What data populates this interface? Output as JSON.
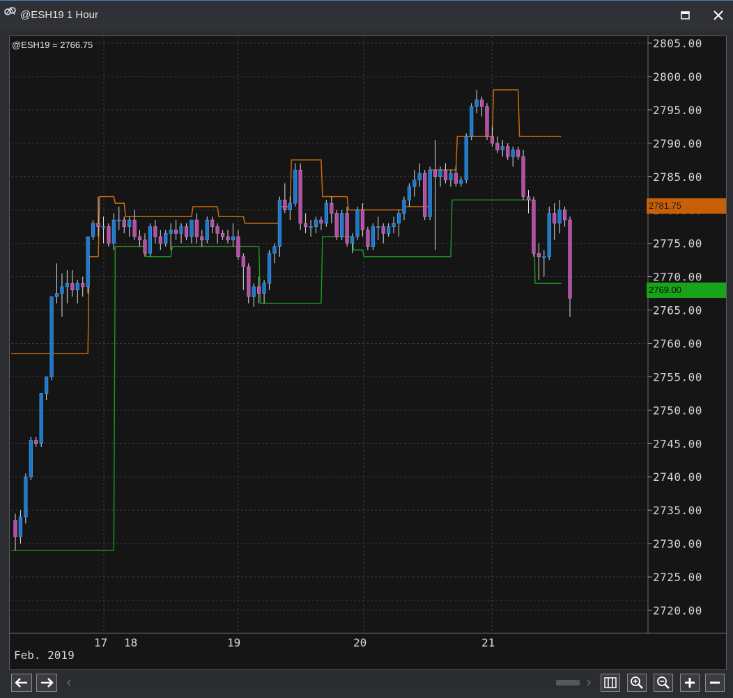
{
  "window": {
    "title": "@ESH19 1 Hour",
    "icons": {
      "app": "globe-icon",
      "maximize": "maximize-icon",
      "close": "close-icon"
    }
  },
  "chart_header": {
    "symbol_label": "@ESH19 = 2766.75"
  },
  "price_tags": {
    "upper": {
      "value": "2781.75",
      "color": "#c8600a"
    },
    "lower": {
      "value": "2769.00",
      "color": "#18a418"
    }
  },
  "x_axis": {
    "month_label": "Feb. 2019",
    "day_labels": [
      "17",
      "18",
      "19",
      "20",
      "21"
    ]
  },
  "colors": {
    "background": "#151515",
    "bull_body": "#1e77c8",
    "bear_body": "#b34fa2",
    "wick": "#e0e0e0",
    "upper_channel": "#d1700f",
    "lower_channel": "#1f9a1f",
    "grid": "#3a3a3a"
  },
  "toolbar": {
    "scroll_left": "arrow-left-icon",
    "scroll_right": "arrow-right-icon",
    "bars_icon": "bar-spacing-icon",
    "zoom_in": "zoom-in-icon",
    "zoom_out": "zoom-out-icon",
    "add": "plus-icon",
    "remove": "minus-icon"
  },
  "chart_data": {
    "type": "candlestick",
    "symbol": "@ESH19",
    "interval": "1 Hour",
    "last_price": 2766.75,
    "ylim": [
      2715,
      2806
    ],
    "y_ticks": [
      "2805.00",
      "2800.00",
      "2795.00",
      "2790.00",
      "2785.00",
      "2780.00",
      "2775.00",
      "2770.00",
      "2765.00",
      "2760.00",
      "2755.00",
      "2750.00",
      "2745.00",
      "2740.00",
      "2735.00",
      "2730.00",
      "2725.00",
      "2720.00"
    ],
    "x_day_labels": [
      "17",
      "18",
      "19",
      "20",
      "21"
    ],
    "grid": true,
    "candles": [
      [
        2733.5,
        2734.5,
        2729.0,
        2731.0
      ],
      [
        2731.0,
        2735.0,
        2730.0,
        2734.0
      ],
      [
        2734.0,
        2740.5,
        2733.0,
        2740.0
      ],
      [
        2740.0,
        2746.0,
        2739.5,
        2745.5
      ],
      [
        2745.5,
        2746.0,
        2744.5,
        2745.0
      ],
      [
        2745.0,
        2752.5,
        2744.5,
        2752.5
      ],
      [
        2752.5,
        2755.0,
        2751.5,
        2755.0
      ],
      [
        2755.0,
        2767.0,
        2754.5,
        2767.0
      ],
      [
        2767.0,
        2772.0,
        2766.0,
        2767.5
      ],
      [
        2767.5,
        2770.5,
        2764.0,
        2768.5
      ],
      [
        2768.5,
        2771.0,
        2766.0,
        2769.0
      ],
      [
        2769.0,
        2771.0,
        2767.0,
        2768.0
      ],
      [
        2768.0,
        2769.5,
        2766.0,
        2769.0
      ],
      [
        2769.0,
        2770.0,
        2767.0,
        2768.5
      ],
      [
        2768.5,
        2776.0,
        2767.5,
        2776.0
      ],
      [
        2776.0,
        2778.5,
        2775.5,
        2778.0
      ],
      [
        2778.0,
        2782.0,
        2776.0,
        2777.5
      ],
      [
        2777.5,
        2779.0,
        2775.0,
        2777.5
      ],
      [
        2777.5,
        2778.0,
        2774.5,
        2775.0
      ],
      [
        2775.0,
        2779.5,
        2774.0,
        2778.5
      ],
      [
        2778.5,
        2780.5,
        2777.0,
        2778.5
      ],
      [
        2778.5,
        2779.0,
        2776.5,
        2777.5
      ],
      [
        2777.5,
        2779.0,
        2776.0,
        2778.5
      ],
      [
        2778.5,
        2780.0,
        2775.5,
        2776.0
      ],
      [
        2776.0,
        2777.0,
        2774.5,
        2775.5
      ],
      [
        2775.5,
        2776.5,
        2773.0,
        2773.5
      ],
      [
        2773.5,
        2778.0,
        2773.0,
        2777.5
      ],
      [
        2777.5,
        2778.5,
        2775.0,
        2776.0
      ],
      [
        2776.0,
        2777.0,
        2774.0,
        2775.0
      ],
      [
        2775.0,
        2777.0,
        2774.5,
        2776.5
      ],
      [
        2776.5,
        2778.0,
        2774.0,
        2777.0
      ],
      [
        2777.0,
        2778.5,
        2775.5,
        2776.5
      ],
      [
        2776.5,
        2778.0,
        2775.0,
        2777.5
      ],
      [
        2777.5,
        2778.0,
        2775.5,
        2776.0
      ],
      [
        2776.0,
        2778.5,
        2775.0,
        2778.5
      ],
      [
        2778.5,
        2779.5,
        2775.0,
        2776.0
      ],
      [
        2776.0,
        2777.0,
        2774.5,
        2775.5
      ],
      [
        2775.5,
        2779.0,
        2775.0,
        2778.5
      ],
      [
        2778.5,
        2779.0,
        2776.5,
        2777.5
      ],
      [
        2777.5,
        2778.0,
        2775.0,
        2776.5
      ],
      [
        2776.5,
        2777.0,
        2775.5,
        2776.0
      ],
      [
        2776.0,
        2777.0,
        2775.0,
        2775.5
      ],
      [
        2775.5,
        2778.0,
        2774.5,
        2776.0
      ],
      [
        2776.0,
        2777.0,
        2772.5,
        2773.0
      ],
      [
        2773.0,
        2773.5,
        2768.0,
        2771.5
      ],
      [
        2771.5,
        2772.0,
        2766.0,
        2767.0
      ],
      [
        2767.0,
        2769.0,
        2765.5,
        2768.5
      ],
      [
        2768.5,
        2770.0,
        2766.0,
        2767.5
      ],
      [
        2767.5,
        2769.5,
        2766.0,
        2769.0
      ],
      [
        2769.0,
        2774.0,
        2768.0,
        2773.5
      ],
      [
        2773.5,
        2775.0,
        2772.0,
        2774.5
      ],
      [
        2774.5,
        2782.0,
        2773.0,
        2781.5
      ],
      [
        2781.5,
        2784.0,
        2779.5,
        2780.0
      ],
      [
        2780.0,
        2782.0,
        2778.5,
        2781.0
      ],
      [
        2781.0,
        2787.0,
        2780.5,
        2786.0
      ],
      [
        2786.0,
        2787.0,
        2777.0,
        2778.0
      ],
      [
        2778.0,
        2779.5,
        2776.5,
        2777.5
      ],
      [
        2777.5,
        2778.5,
        2776.0,
        2777.5
      ],
      [
        2777.5,
        2779.0,
        2776.5,
        2778.5
      ],
      [
        2778.5,
        2779.0,
        2777.0,
        2778.0
      ],
      [
        2778.0,
        2781.5,
        2777.5,
        2781.0
      ],
      [
        2781.0,
        2782.0,
        2778.0,
        2779.5
      ],
      [
        2779.5,
        2780.0,
        2775.5,
        2776.0
      ],
      [
        2776.0,
        2780.0,
        2775.5,
        2779.5
      ],
      [
        2779.5,
        2780.5,
        2774.5,
        2775.0
      ],
      [
        2775.0,
        2776.5,
        2773.5,
        2776.0
      ],
      [
        2776.0,
        2780.5,
        2775.5,
        2780.0
      ],
      [
        2780.0,
        2781.0,
        2776.0,
        2777.0
      ],
      [
        2777.0,
        2777.5,
        2774.0,
        2774.5
      ],
      [
        2774.5,
        2778.0,
        2774.0,
        2777.5
      ],
      [
        2777.5,
        2779.0,
        2775.5,
        2777.5
      ],
      [
        2777.5,
        2778.0,
        2775.0,
        2776.5
      ],
      [
        2776.5,
        2778.0,
        2776.0,
        2777.5
      ],
      [
        2777.5,
        2779.0,
        2776.5,
        2778.0
      ],
      [
        2778.0,
        2780.0,
        2776.0,
        2779.5
      ],
      [
        2779.5,
        2782.0,
        2778.5,
        2781.5
      ],
      [
        2781.5,
        2784.0,
        2780.5,
        2783.5
      ],
      [
        2783.5,
        2786.0,
        2782.0,
        2784.5
      ],
      [
        2784.5,
        2787.0,
        2783.5,
        2785.5
      ],
      [
        2785.5,
        2786.0,
        2778.5,
        2779.0
      ],
      [
        2779.0,
        2786.5,
        2778.5,
        2786.0
      ],
      [
        2786.0,
        2790.5,
        2774.0,
        2785.0
      ],
      [
        2785.0,
        2786.5,
        2783.5,
        2786.0
      ],
      [
        2786.0,
        2787.0,
        2784.0,
        2784.5
      ],
      [
        2784.5,
        2786.0,
        2783.5,
        2785.5
      ],
      [
        2785.5,
        2786.5,
        2783.5,
        2784.0
      ],
      [
        2784.0,
        2785.0,
        2783.5,
        2784.5
      ],
      [
        2784.5,
        2791.5,
        2784.0,
        2791.0
      ],
      [
        2791.0,
        2796.0,
        2790.5,
        2795.5
      ],
      [
        2795.5,
        2798.0,
        2794.5,
        2796.5
      ],
      [
        2796.5,
        2797.0,
        2794.0,
        2795.5
      ],
      [
        2795.5,
        2796.0,
        2790.5,
        2791.0
      ],
      [
        2791.0,
        2792.5,
        2789.5,
        2790.0
      ],
      [
        2790.0,
        2791.0,
        2788.5,
        2789.0
      ],
      [
        2789.0,
        2790.5,
        2788.0,
        2789.5
      ],
      [
        2789.5,
        2790.0,
        2787.5,
        2788.0
      ],
      [
        2788.0,
        2789.5,
        2786.5,
        2789.0
      ],
      [
        2789.0,
        2789.5,
        2787.5,
        2788.0
      ],
      [
        2788.0,
        2789.0,
        2781.5,
        2782.0
      ],
      [
        2782.0,
        2783.0,
        2779.5,
        2781.5
      ],
      [
        2781.5,
        2782.0,
        2773.0,
        2773.5
      ],
      [
        2773.5,
        2775.0,
        2769.5,
        2773.0
      ],
      [
        2773.0,
        2774.0,
        2770.0,
        2773.0
      ],
      [
        2773.0,
        2780.5,
        2772.5,
        2779.5
      ],
      [
        2779.5,
        2781.0,
        2775.5,
        2778.0
      ],
      [
        2778.0,
        2781.5,
        2776.5,
        2780.0
      ],
      [
        2780.0,
        2780.5,
        2777.5,
        2778.5
      ],
      [
        2778.5,
        2779.0,
        2764.0,
        2766.75
      ]
    ],
    "upper_channel_series": "orange donchian-style upper band (2758.5 → 2782 → 2779 → 2787.5 → 2780 → 2791 → 2798 → 2791)",
    "lower_channel_series": "green donchian-style lower band (2729 → 2774.5 → 2773 → 2774.5 → 2766 → 2776 → 2773 → 2781.5 → 2769)"
  }
}
